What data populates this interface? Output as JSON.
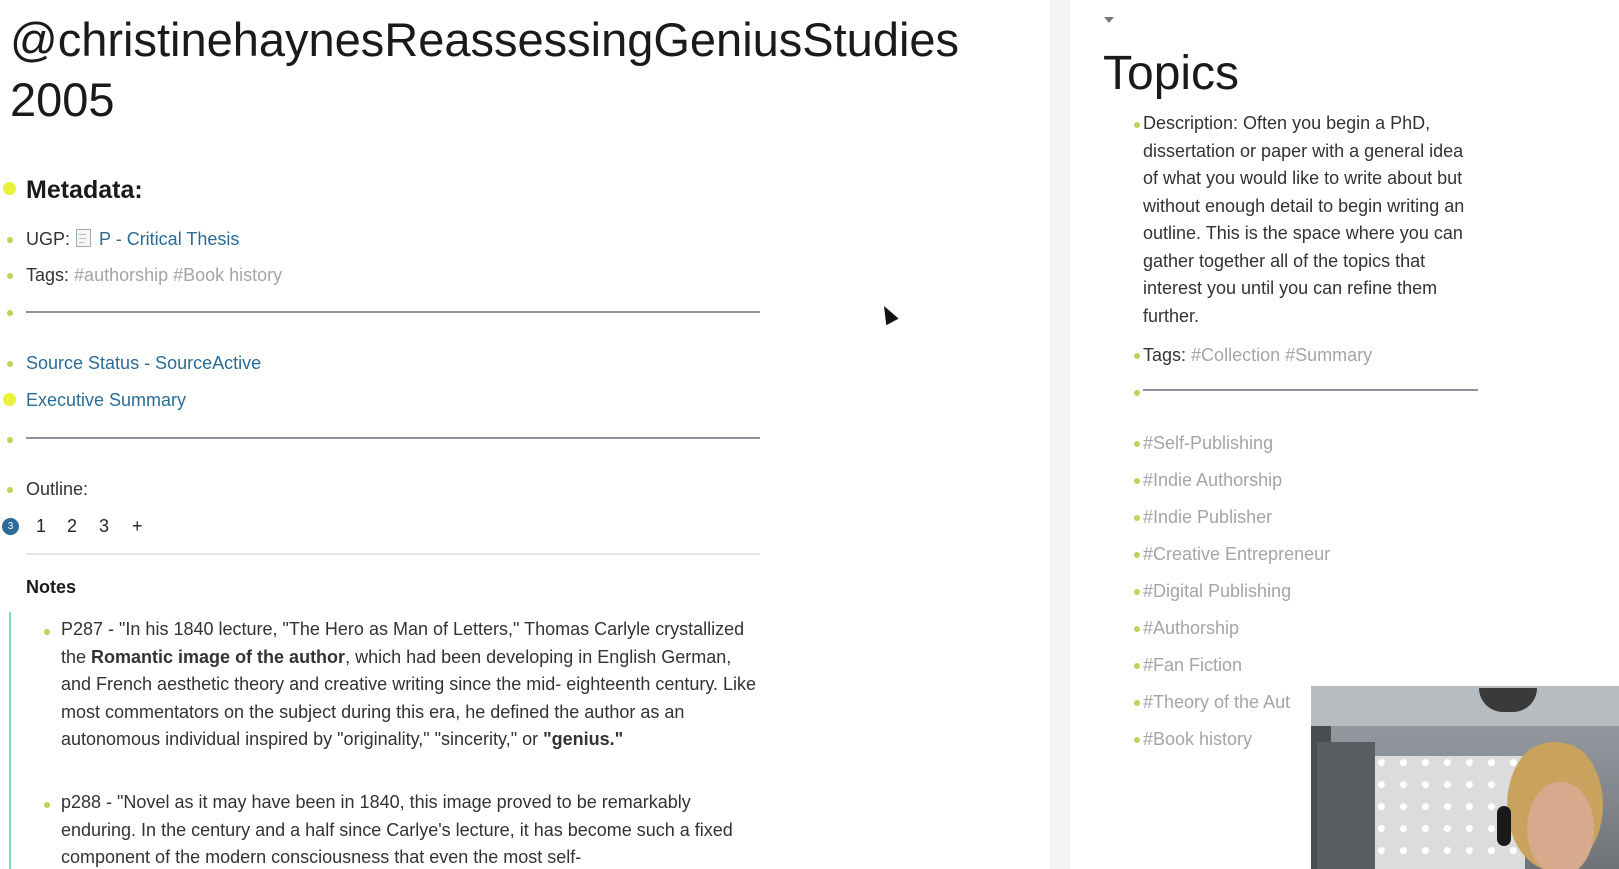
{
  "page": {
    "title": "@christinehaynesReassessingGeniusStudies2005"
  },
  "metadata": {
    "heading": "Metadata:",
    "ugp_label": "UGP:",
    "ugp_link": "P - Critical Thesis",
    "tags_label": "Tags:",
    "tags": "#authorship #Book history",
    "source_status": "Source Status - SourceActive",
    "executive_summary": "Executive Summary"
  },
  "outline": {
    "label": "Outline:",
    "badge": "3",
    "items": [
      "1",
      "2",
      "3",
      "+"
    ]
  },
  "notes": {
    "label": "Notes",
    "items": [
      {
        "prefix": "P287 - \"In his 1840 lecture, \"The Hero as Man of Letters,\" Thomas Carlyle crystallized the ",
        "bold1": "Romantic image of the author",
        "middle": ", which had been developing in English German, and French aesthetic theory and creative writing since the mid- eighteenth century. Like most commentators on the subject during this era, he defined the author as an autonomous individual inspired by \"originality,\" \"sincerity,\" or ",
        "bold2": "\"genius.\""
      },
      {
        "text": "p288 - \"Novel as it may have been in 1840, this image proved to be remarkably enduring. In the century and a half since Carlye's lecture, it has become such a fixed component of the modern consciousness that even the most self-"
      }
    ]
  },
  "sidebar": {
    "title": "Topics",
    "description": "Description: Often you begin a PhD, dissertation or paper with a general idea of what you would like to write about but without enough detail to begin writing an outline. This is the space where you can gather together all of the topics that interest you until you can refine them further.",
    "tags_label": "Tags:",
    "tags": "#Collection #Summary",
    "topic_tags": [
      "#Self-Publishing",
      "#Indie Authorship",
      "#Indie Publisher",
      "#Creative Entrepreneur",
      "#Digital Publishing",
      "#Authorship",
      "#Fan Fiction",
      "#Theory of the Aut",
      "#Book history"
    ]
  },
  "icons": {
    "collapse": "caret-down-icon",
    "ugp_page": "page-icon",
    "cursor": "mouse-pointer-icon"
  },
  "colors": {
    "link": "#2a6c96",
    "tag": "#a5a5a5",
    "bullet": "#b9d55a",
    "highlight_bullet": "#e7f23b",
    "outline_badge": "#2c6a9a",
    "notes_bar": "#7ed9b7"
  }
}
